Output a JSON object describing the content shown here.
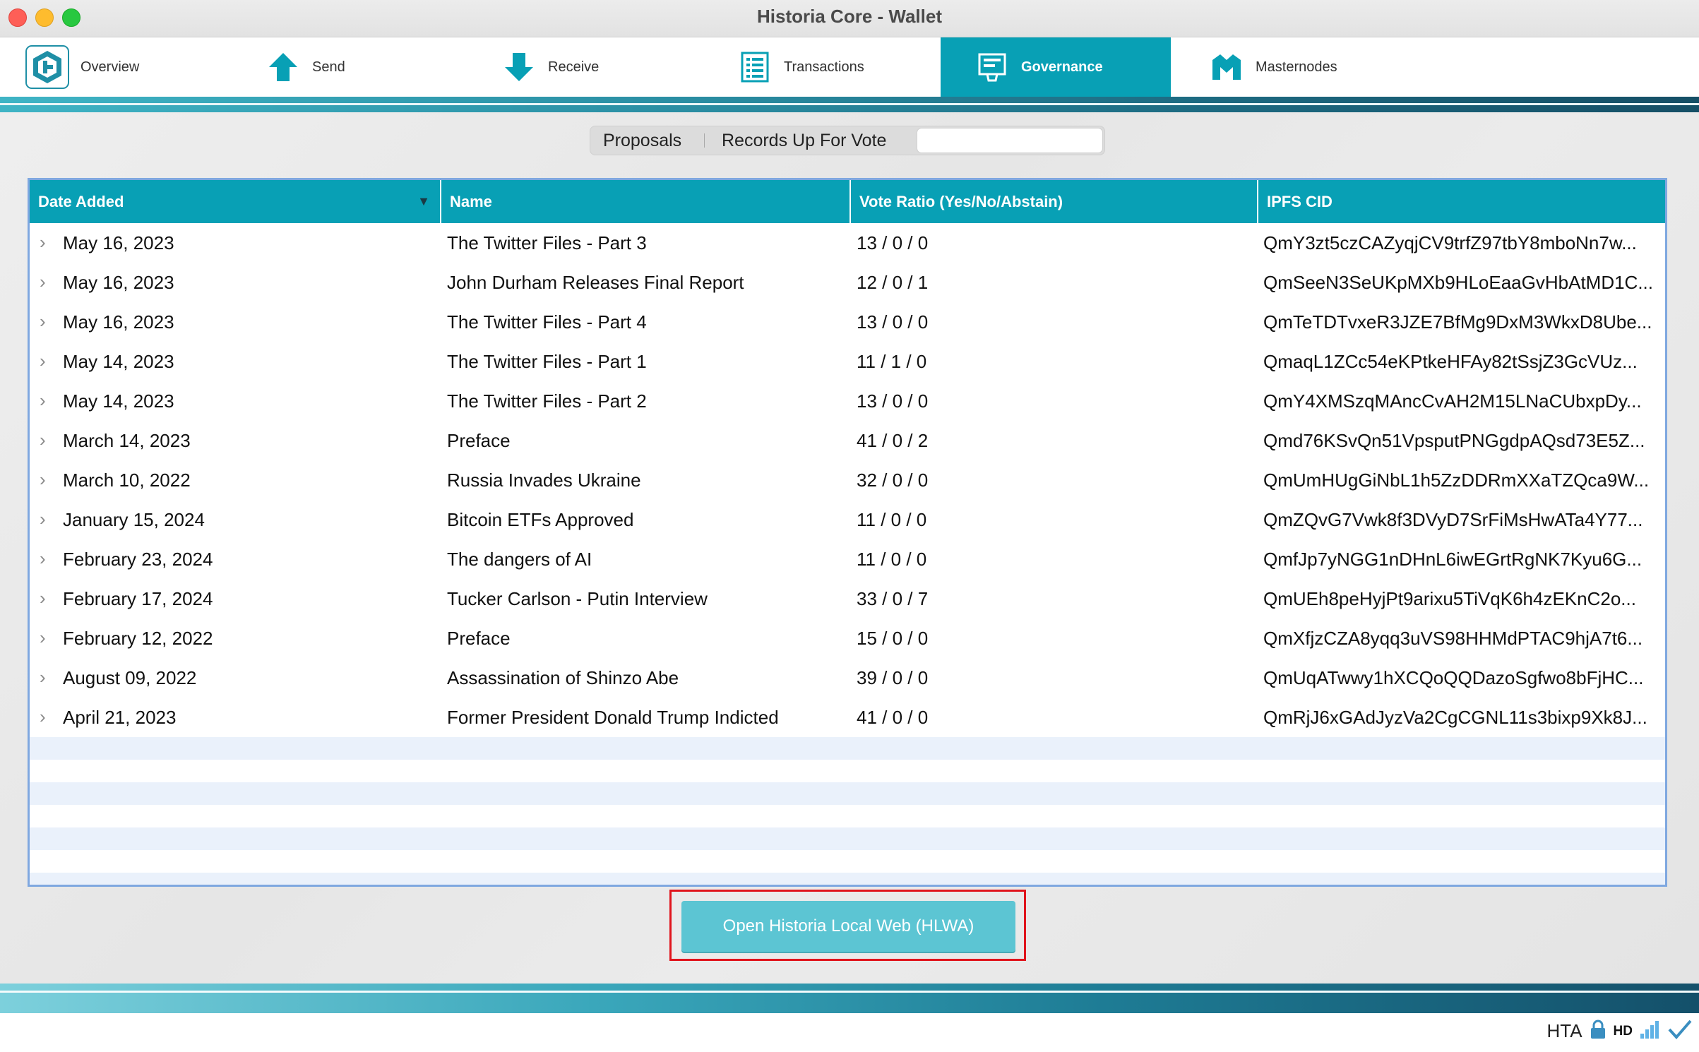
{
  "window": {
    "title": "Historia Core - Wallet"
  },
  "toolbar": {
    "tabs": [
      {
        "label": "Overview",
        "icon": "logo-icon"
      },
      {
        "label": "Send",
        "icon": "arrow-up-icon"
      },
      {
        "label": "Receive",
        "icon": "arrow-down-icon"
      },
      {
        "label": "Transactions",
        "icon": "list-icon"
      },
      {
        "label": "Governance",
        "icon": "governance-icon",
        "active": true
      },
      {
        "label": "Masternodes",
        "icon": "masternodes-icon"
      }
    ]
  },
  "subtabs": {
    "proposals": "Proposals",
    "records": "Records Up For Vote",
    "search_value": ""
  },
  "table": {
    "columns": [
      "Date Added",
      "Name",
      "Vote Ratio (Yes/No/Abstain)",
      "IPFS CID"
    ],
    "sort_indicator": "▼",
    "rows": [
      {
        "date": "May 16, 2023",
        "name": "The Twitter Files - Part 3",
        "votes": "13 / 0 / 0",
        "cid": "QmY3zt5czCAZyqjCV9trfZ97tbY8mboNn7w..."
      },
      {
        "date": "May 16, 2023",
        "name": "John Durham Releases Final Report",
        "votes": "12 / 0 / 1",
        "cid": "QmSeeN3SeUKpMXb9HLoEaaGvHbAtMD1C..."
      },
      {
        "date": "May 16, 2023",
        "name": "The Twitter Files - Part 4",
        "votes": "13 / 0 / 0",
        "cid": "QmTeTDTvxeR3JZE7BfMg9DxM3WkxD8Ube..."
      },
      {
        "date": "May 14, 2023",
        "name": "The Twitter Files - Part 1",
        "votes": "11 / 1 / 0",
        "cid": "QmaqL1ZCc54eKPtkeHFAy82tSsjZ3GcVUz..."
      },
      {
        "date": "May 14, 2023",
        "name": "The Twitter Files - Part 2",
        "votes": "13 / 0 / 0",
        "cid": "QmY4XMSzqMAncCvAH2M15LNaCUbxpDy..."
      },
      {
        "date": "March 14, 2023",
        "name": "Preface",
        "votes": "41 / 0 / 2",
        "cid": "Qmd76KSvQn51VpsputPNGgdpAQsd73E5Z..."
      },
      {
        "date": "March 10, 2022",
        "name": "Russia Invades Ukraine",
        "votes": "32 / 0 / 0",
        "cid": "QmUmHUgGiNbL1h5ZzDDRmXXaTZQca9W..."
      },
      {
        "date": "January 15, 2024",
        "name": "Bitcoin ETFs Approved",
        "votes": "11 / 0 / 0",
        "cid": "QmZQvG7Vwk8f3DVyD7SrFiMsHwATa4Y77..."
      },
      {
        "date": "February 23, 2024",
        "name": "The dangers of AI",
        "votes": "11 / 0 / 0",
        "cid": "QmfJp7yNGG1nDHnL6iwEGrtRgNK7Kyu6G..."
      },
      {
        "date": "February 17, 2024",
        "name": "Tucker Carlson - Putin Interview",
        "votes": "33 / 0 / 7",
        "cid": "QmUEh8peHyjPt9arixu5TiVqK6h4zEKnC2o..."
      },
      {
        "date": "February 12, 2022",
        "name": "Preface",
        "votes": "15 / 0 / 0",
        "cid": "QmXfjzCZA8yqq3uVS98HHMdPTAC9hjA7t6..."
      },
      {
        "date": "August 09, 2022",
        "name": "Assassination of Shinzo Abe",
        "votes": "39 / 0 / 0",
        "cid": "QmUqATwwy1hXCQoQQDazoSgfwo8bFjHC..."
      },
      {
        "date": "April 21, 2023",
        "name": "Former President Donald Trump Indicted",
        "votes": "41 / 0 / 0",
        "cid": "QmRjJ6xGAdJyzVa2CgCGNL11s3bixp9Xk8J..."
      }
    ]
  },
  "actions": {
    "open_web": "Open Historia Local Web (HLWA)"
  },
  "statusbar": {
    "unit": "HTA",
    "hd": "HD",
    "icons": [
      "lock-icon",
      "hd-icon",
      "signal-icon",
      "checkmark-icon"
    ]
  },
  "colors": {
    "accent": "#08a0b5",
    "highlight_frame": "#e0141c",
    "button": "#5cc5d3"
  }
}
